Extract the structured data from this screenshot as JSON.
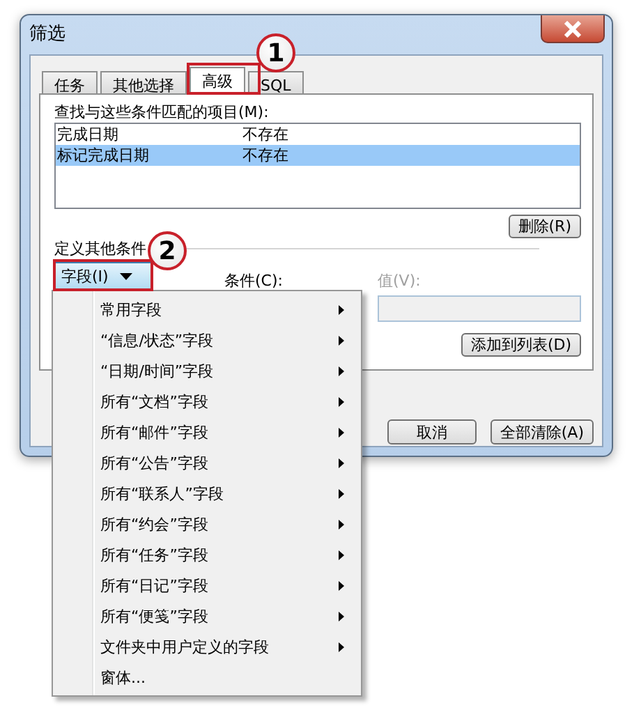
{
  "window": {
    "title": "筛选"
  },
  "tabs": [
    {
      "label": "任务",
      "selected": false
    },
    {
      "label": "其他选择",
      "selected": false
    },
    {
      "label": "高级",
      "selected": true
    },
    {
      "label": "SQL",
      "selected": false
    }
  ],
  "criteria": {
    "label": "查找与这些条件匹配的项目(M):",
    "rows": [
      {
        "field": "完成日期",
        "condition": "不存在",
        "selected": false
      },
      {
        "field": "标记完成日期",
        "condition": "不存在",
        "selected": true
      }
    ],
    "remove_button": "删除(R)"
  },
  "define": {
    "label": "定义其他条件",
    "field_button": "字段(I)",
    "condition_label": "条件(C):",
    "value_label": "值(V):",
    "value_disabled": true,
    "add_button": "添加到列表(D)"
  },
  "buttons": [
    {
      "label": "取消"
    },
    {
      "label": "全部清除(A)"
    }
  ],
  "menu": {
    "items": [
      {
        "label": "常用字段",
        "submenu": true
      },
      {
        "label": "“信息/状态”字段",
        "submenu": true
      },
      {
        "label": "“日期/时间”字段",
        "submenu": true
      },
      {
        "label": "所有“文档”字段",
        "submenu": true
      },
      {
        "label": "所有“邮件”字段",
        "submenu": true
      },
      {
        "label": "所有“公告”字段",
        "submenu": true
      },
      {
        "label": "所有“联系人”字段",
        "submenu": true
      },
      {
        "label": "所有“约会”字段",
        "submenu": true
      },
      {
        "label": "所有“任务”字段",
        "submenu": true
      },
      {
        "label": "所有“日记”字段",
        "submenu": true
      },
      {
        "label": "所有“便笺”字段",
        "submenu": true
      },
      {
        "label": "文件夹中用户定义的字段",
        "submenu": true
      },
      {
        "label": "窗体...",
        "submenu": false
      }
    ]
  },
  "callouts": [
    {
      "number": "1"
    },
    {
      "number": "2"
    }
  ]
}
